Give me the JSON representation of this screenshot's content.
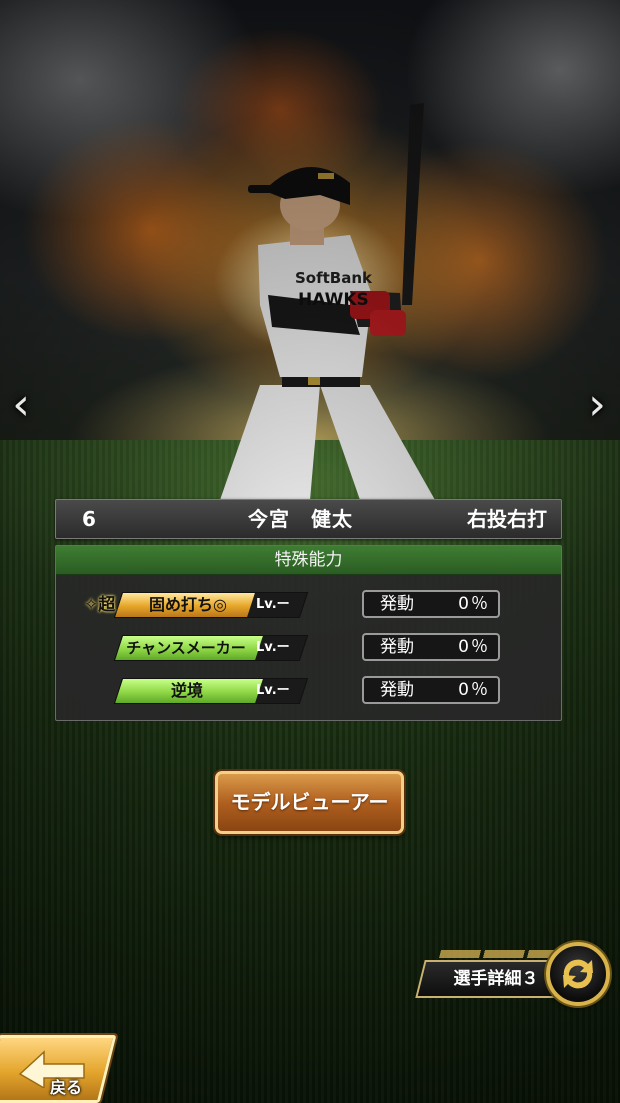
{
  "player": {
    "uniform_number": "6",
    "name": "今宮　健太",
    "handedness": "右投右打",
    "jersey_text": "SoftBank HAWKS"
  },
  "abilities_panel": {
    "title": "特殊能力",
    "items": [
      {
        "prefix": "✧超",
        "name": "固め打ち◎",
        "level": "Lv.ー",
        "trigger_label": "発動",
        "trigger_value": "0％",
        "color": "#e6a528"
      },
      {
        "prefix": "",
        "name": "チャンスメーカー",
        "level": "Lv.ー",
        "trigger_label": "発動",
        "trigger_value": "0％",
        "color": "#8fd846"
      },
      {
        "prefix": "",
        "name": "逆境",
        "level": "Lv.ー",
        "trigger_label": "発動",
        "trigger_value": "0％",
        "color": "#8fd846"
      }
    ]
  },
  "nav": {
    "prev_icon": "chevron-left-icon",
    "next_icon": "chevron-right-icon",
    "prev_glyph": "‹",
    "next_glyph": "›"
  },
  "model_viewer_button": {
    "label": "モデルビューアー"
  },
  "player_detail": {
    "label": "選手詳細３",
    "switch_icon": "swap-arrows-icon"
  },
  "back_button": {
    "label": "戻る",
    "icon": "back-arrow-icon"
  },
  "colors": {
    "panel_header": "#3f7d33",
    "gold_accent": "#d8b24a",
    "button_brown": "#b0601f"
  }
}
